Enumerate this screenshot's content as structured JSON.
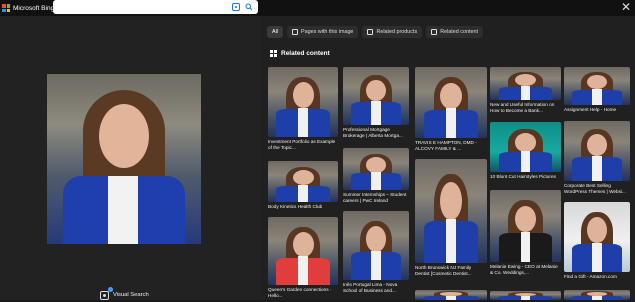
{
  "app": {
    "brand": "Microsoft Bing"
  },
  "topbar": {
    "close_icon": "close-icon",
    "visual_search_icon": "visual-search-icon",
    "search_icon": "search-icon"
  },
  "left_panel": {
    "visual_search_label": "Visual Search"
  },
  "tabs": [
    {
      "label": "All"
    },
    {
      "label": "Pages with this image"
    },
    {
      "label": "Related products"
    },
    {
      "label": "Related content"
    }
  ],
  "section": {
    "title": "Related content"
  },
  "results": [
    {
      "caption": "Investment Portfolio as Example of the Topic..."
    },
    {
      "caption": "Professional Mortgage Brokerage | Alberta Mortga..."
    },
    {
      "caption": "TRAVIS E HAMPTON, DMD - ALCOVY FAMILY & ..."
    },
    {
      "caption": "New and Useful Information on How to Become a Bank..."
    },
    {
      "caption": "Assignment Help - Home"
    },
    {
      "caption": "10 Blunt Cut Hairstyles Pictures"
    },
    {
      "caption": "Corporate Best Selling WordPress Themes | Websi..."
    },
    {
      "caption": "Body Kinetics Health Club"
    },
    {
      "caption": "Summer Internships – Student careers | PwC Ireland"
    },
    {
      "caption": "North Brunswick NJ Family Dentist [Cosmetic Dentist..."
    },
    {
      "caption": "Melanie Ewing - CEO at Melanie & Co. Weddings,..."
    },
    {
      "caption": "Find a Gift - Amazon.com"
    },
    {
      "caption": "Queen's Garden connections · Hello..."
    },
    {
      "caption": "Inês Portugal Lima - Nova School of Business and..."
    },
    {
      "caption": ""
    },
    {
      "caption": ""
    },
    {
      "caption": ""
    }
  ]
}
